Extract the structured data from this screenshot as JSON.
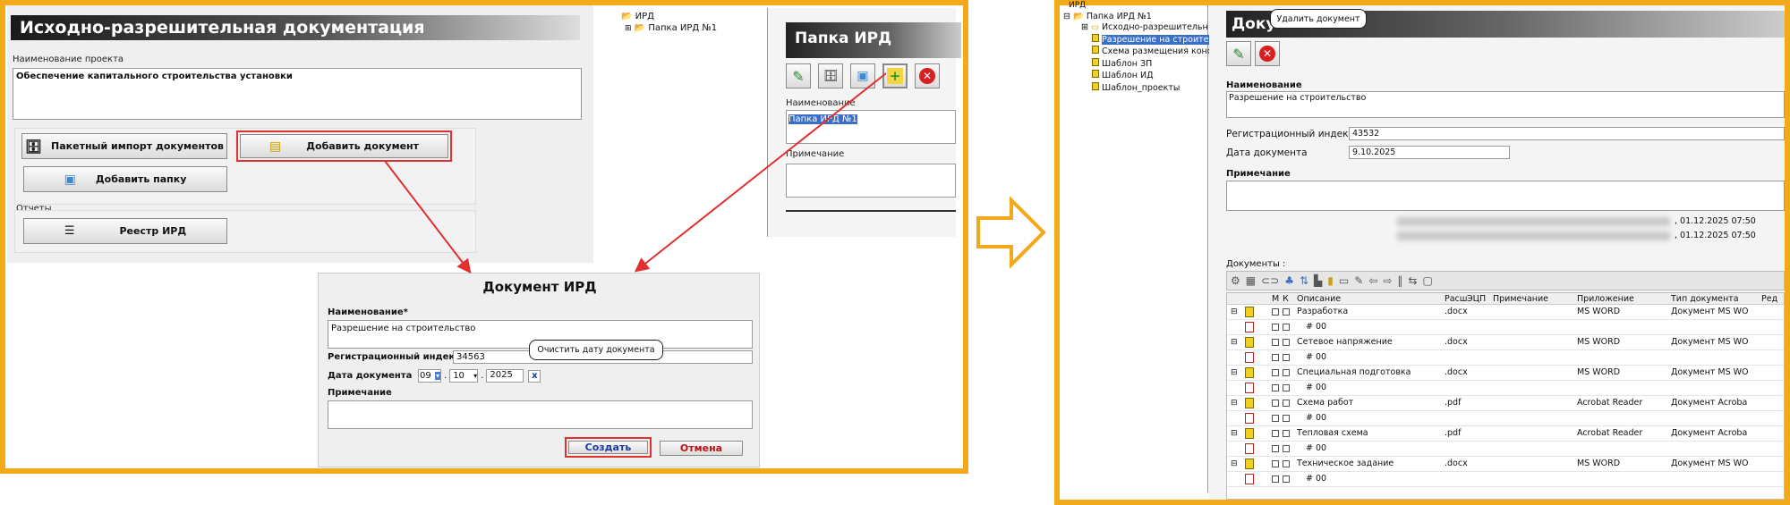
{
  "left": {
    "title": "Исходно-разрешительная документация",
    "project_label": "Наименование проекта",
    "project_value": "Обеспечение капитального строительства установки",
    "btn_batch_import": "Пакетный импорт документов",
    "btn_add_document": "Добавить документ",
    "btn_add_folder": "Добавить папку",
    "reports_label": "Отчеты",
    "btn_registry": "Реестр ИРД"
  },
  "tree_small": {
    "root": "ИРД",
    "child": "Папка ИРД №1"
  },
  "folder_panel": {
    "title": "Папка ИРД",
    "name_label": "Наименование",
    "name_value": "Папка ИРД №1",
    "note_label": "Примечание"
  },
  "dialog": {
    "title": "Документ ИРД",
    "name_label": "Наименование*",
    "name_value": "Разрешение на строительство",
    "reg_label": "Регистрационный индекс",
    "reg_value": "34563",
    "date_label": "Дата документа",
    "date_day": "09",
    "date_month": "10",
    "date_year": "2025",
    "date_sep": ".",
    "clear_btn": "x",
    "tooltip": "Очистить дату документа",
    "note_label": "Примечание",
    "create_btn": "Создать",
    "cancel_btn": "Отмена"
  },
  "right": {
    "tree": {
      "root": "ИРД",
      "folder": "Папка ИРД №1",
      "items": [
        "Исходно-разрешительн",
        "Разрешение на строител",
        "Схема размещения конст",
        "Шаблон ЗП",
        "Шаблон ИД",
        "Шаблон_проекты"
      ]
    },
    "title": "Доку",
    "tooltip": "Удалить документ",
    "name_label": "Наименование",
    "name_value": "Разрешение на строительство",
    "reg_label": "Регистрационный индекс",
    "reg_value": "43532",
    "date_label": "Дата документа",
    "date_value": "9.10.2025",
    "note_label": "Примечание",
    "stamp1": ", 01.12.2025 07:50",
    "stamp2": ", 01.12.2025 07:50",
    "docs_label": "Документы :",
    "grid_headers": [
      "М",
      "К",
      "Описание",
      "Расш",
      "ЭЦП",
      "Примечание",
      "Приложение",
      "Тип документа",
      "Ред"
    ],
    "rows": [
      {
        "desc": "Разработка",
        "ext": ".docx",
        "app": "MS WORD",
        "type": "Документ MS WO",
        "sub": "# 00"
      },
      {
        "desc": "Сетевое напряжение",
        "ext": ".docx",
        "app": "MS WORD",
        "type": "Документ MS WO",
        "sub": "# 00"
      },
      {
        "desc": "Специальная подготовка",
        "ext": ".docx",
        "app": "MS WORD",
        "type": "Документ MS WO",
        "sub": "# 00"
      },
      {
        "desc": "Схема работ",
        "ext": ".pdf",
        "app": "Acrobat Reader",
        "type": "Документ Acroba",
        "sub": "# 00"
      },
      {
        "desc": "Тепловая схема",
        "ext": ".pdf",
        "app": "Acrobat Reader",
        "type": "Документ Acroba",
        "sub": "# 00"
      },
      {
        "desc": "Техническое задание",
        "ext": ".docx",
        "app": "MS WORD",
        "type": "Документ MS WO",
        "sub": "# 00"
      }
    ]
  },
  "colors": {
    "frame": "#f2a91a",
    "highlight": "#e03030",
    "selection": "#3a6fc9"
  }
}
